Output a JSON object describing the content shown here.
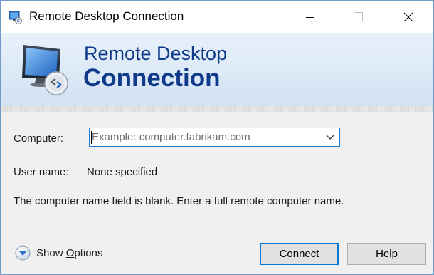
{
  "window": {
    "title": "Remote Desktop Connection"
  },
  "banner": {
    "line1": "Remote Desktop",
    "line2": "Connection"
  },
  "form": {
    "computer_label": "Computer:",
    "computer_placeholder": "Example: computer.fabrikam.com",
    "computer_value": "",
    "username_label": "User name:",
    "username_value": "None specified",
    "message": "The computer name field is blank. Enter a full remote computer name."
  },
  "footer": {
    "show_options_prefix": "Show ",
    "show_options_underlined": "O",
    "show_options_rest": "ptions",
    "connect_label": "Connect",
    "help_label": "Help"
  },
  "colors": {
    "accent": "#0078d7",
    "banner_text": "#0f3a8a",
    "banner_bg": "#dbe8f6"
  },
  "icons": {
    "app": "remote-desktop-icon",
    "minimize": "minimize-icon",
    "maximize": "maximize-icon",
    "close": "close-icon",
    "dropdown": "chevron-down-icon",
    "show_options": "expand-circle-icon"
  }
}
